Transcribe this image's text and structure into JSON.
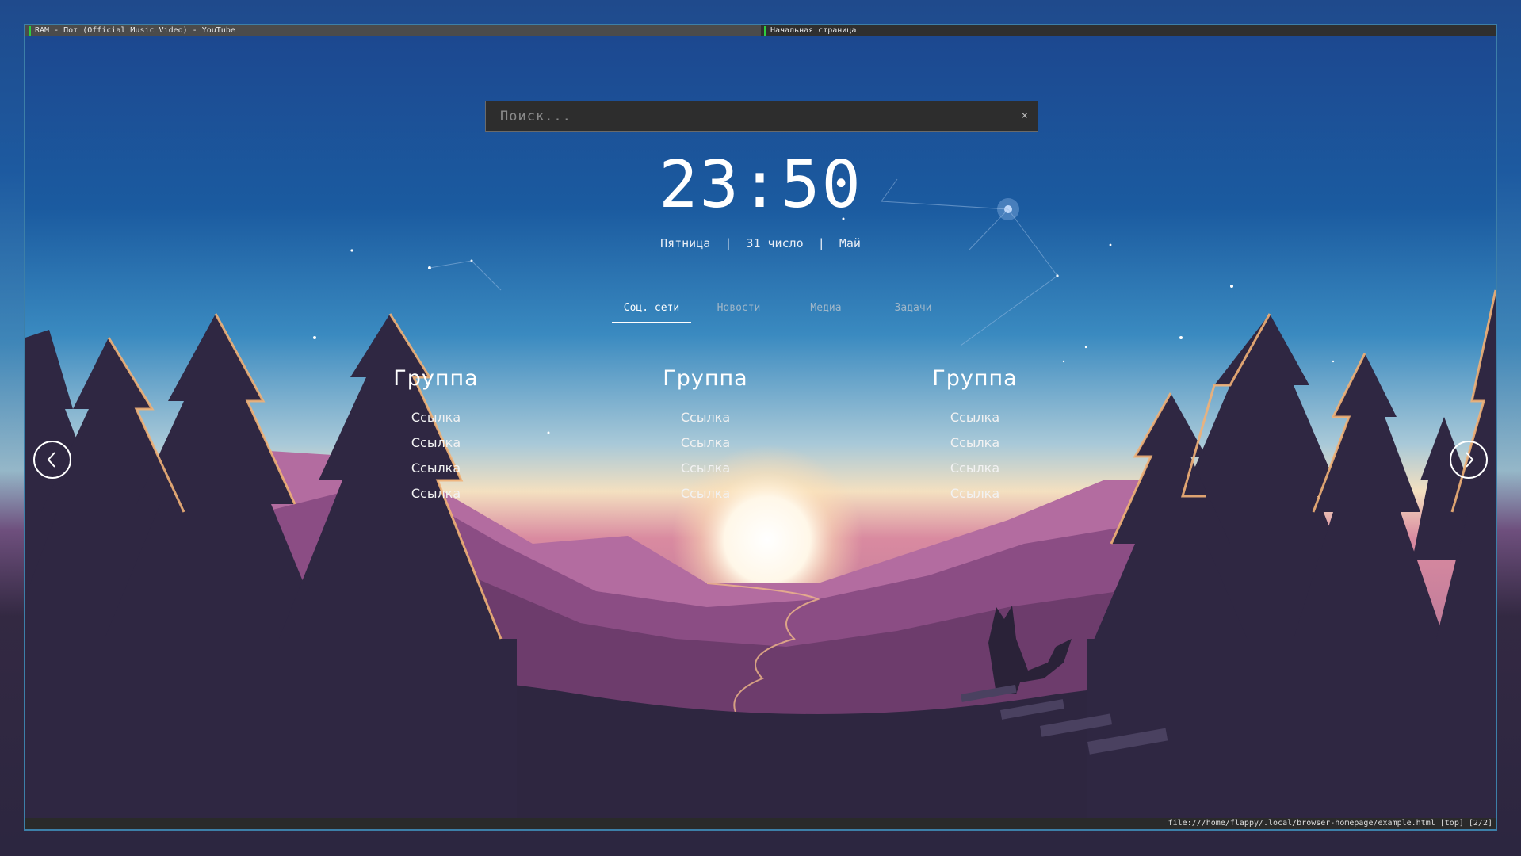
{
  "browser": {
    "tabs": [
      {
        "title": "RAM - Пот (Official Music Video) - YouTube",
        "active": true
      },
      {
        "title": "Начальная страница",
        "active": false
      }
    ],
    "status_url": "file:///home/flappy/.local/browser-homepage/example.html [top] [2/2]"
  },
  "search": {
    "placeholder": "Поиск...",
    "clear_icon": "×"
  },
  "clock": {
    "time": "23:50",
    "date": "Пятница  |  31 число  |  Май"
  },
  "nav": {
    "tabs": [
      {
        "label": "Соц. сети",
        "active": true
      },
      {
        "label": "Новости",
        "active": false
      },
      {
        "label": "Медиа",
        "active": false
      },
      {
        "label": "Задачи",
        "active": false
      }
    ]
  },
  "groups": [
    {
      "title": "Группа",
      "links": [
        "Ссылка",
        "Ссылка",
        "Ссылка",
        "Ссылка"
      ]
    },
    {
      "title": "Группа",
      "links": [
        "Ссылка",
        "Ссылка",
        "Ссылка",
        "Ссылка"
      ]
    },
    {
      "title": "Группа",
      "links": [
        "Ссылка",
        "Ссылка",
        "Ссылка",
        "Ссылка"
      ]
    }
  ],
  "icons": {
    "prev": "chevron-left-icon",
    "next": "chevron-right-icon"
  },
  "colors": {
    "accent": "#ffffff",
    "window_border": "#3d7fa8",
    "tab_marker": "#2ecc40"
  }
}
